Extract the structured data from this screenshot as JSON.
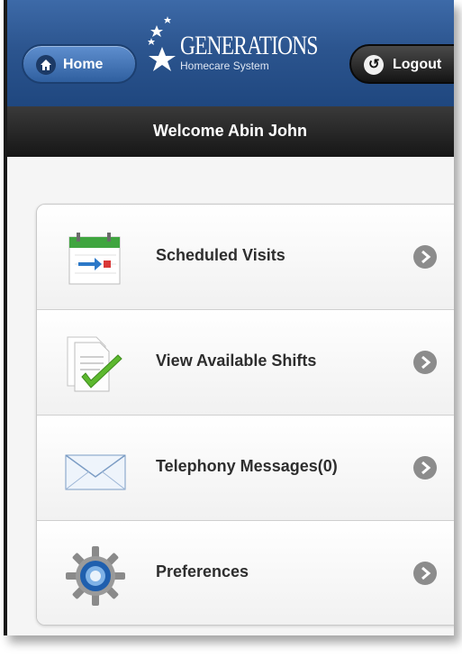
{
  "header": {
    "home_label": "Home",
    "logo_brand": "GENERATIONS",
    "logo_tagline": "Homecare System",
    "logout_label": "Logout"
  },
  "welcome_text": "Welcome Abin John",
  "menu": {
    "items": [
      {
        "label": "Scheduled Visits",
        "icon": "calendar-icon"
      },
      {
        "label": "View Available Shifts",
        "icon": "checkmark-document-icon"
      },
      {
        "label": "Telephony Messages(0)",
        "icon": "envelope-icon"
      },
      {
        "label": "Preferences",
        "icon": "gear-icon"
      }
    ]
  },
  "colors": {
    "header_blue": "#2c558f",
    "welcome_bar": "#1f1f1f",
    "arrow_gray": "#8c8c8c"
  }
}
